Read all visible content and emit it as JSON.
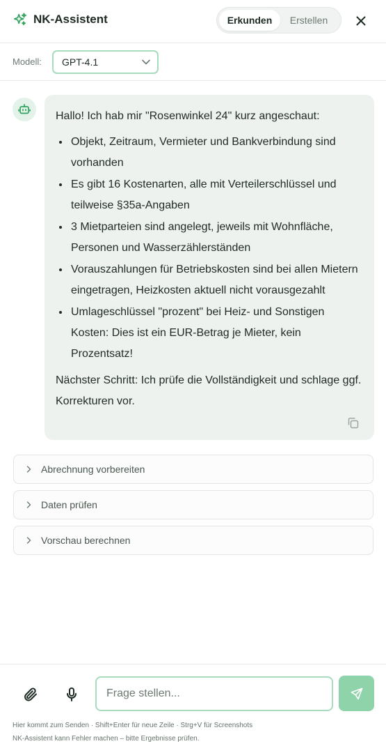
{
  "header": {
    "title": "NK-Assistent",
    "tabs": [
      {
        "label": "Erkunden",
        "active": true
      },
      {
        "label": "Erstellen",
        "active": false
      }
    ],
    "close_icon": "close-icon"
  },
  "model": {
    "label": "Modell:",
    "value": "GPT-4.1"
  },
  "message": {
    "intro": "Hallo! Ich hab mir \"Rosenwinkel 24\" kurz angeschaut:",
    "bullets": [
      "Objekt, Zeitraum, Vermieter und Bankverbindung sind vorhanden",
      "Es gibt 16 Kostenarten, alle mit Verteilerschlüssel und teilweise §35a-Angaben",
      "3 Mietparteien sind angelegt, jeweils mit Wohnfläche, Personen und Wasserzählerständen",
      "Vorauszahlungen für Betriebskosten sind bei allen Mietern eingetragen, Heizkosten aktuell nicht vorausgezahlt",
      "Umlageschlüssel \"prozent\" bei Heiz- und Sonstigen Kosten: Dies ist ein EUR-Betrag je Mieter, kein Prozentsatz!"
    ],
    "outro": "Nächster Schritt: Ich prüfe die Vollständigkeit und schlage ggf. Korrekturen vor."
  },
  "actions": [
    {
      "label": "Abrechnung vorbereiten"
    },
    {
      "label": "Daten prüfen"
    },
    {
      "label": "Vorschau berechnen"
    }
  ],
  "composer": {
    "placeholder": "Frage stellen...",
    "hint_line1": "Hier kommt zum Senden · Shift+Enter für neue Zeile · Strg+V für Screenshots",
    "hint_line2": "NK-Assistent kann Fehler machen – bitte Ergebnisse prüfen."
  },
  "colors": {
    "accent": "#2fa35f",
    "accent_light": "#a7dcbf",
    "send_button": "#8fd3aa",
    "bubble_bg": "#eef2ef"
  }
}
